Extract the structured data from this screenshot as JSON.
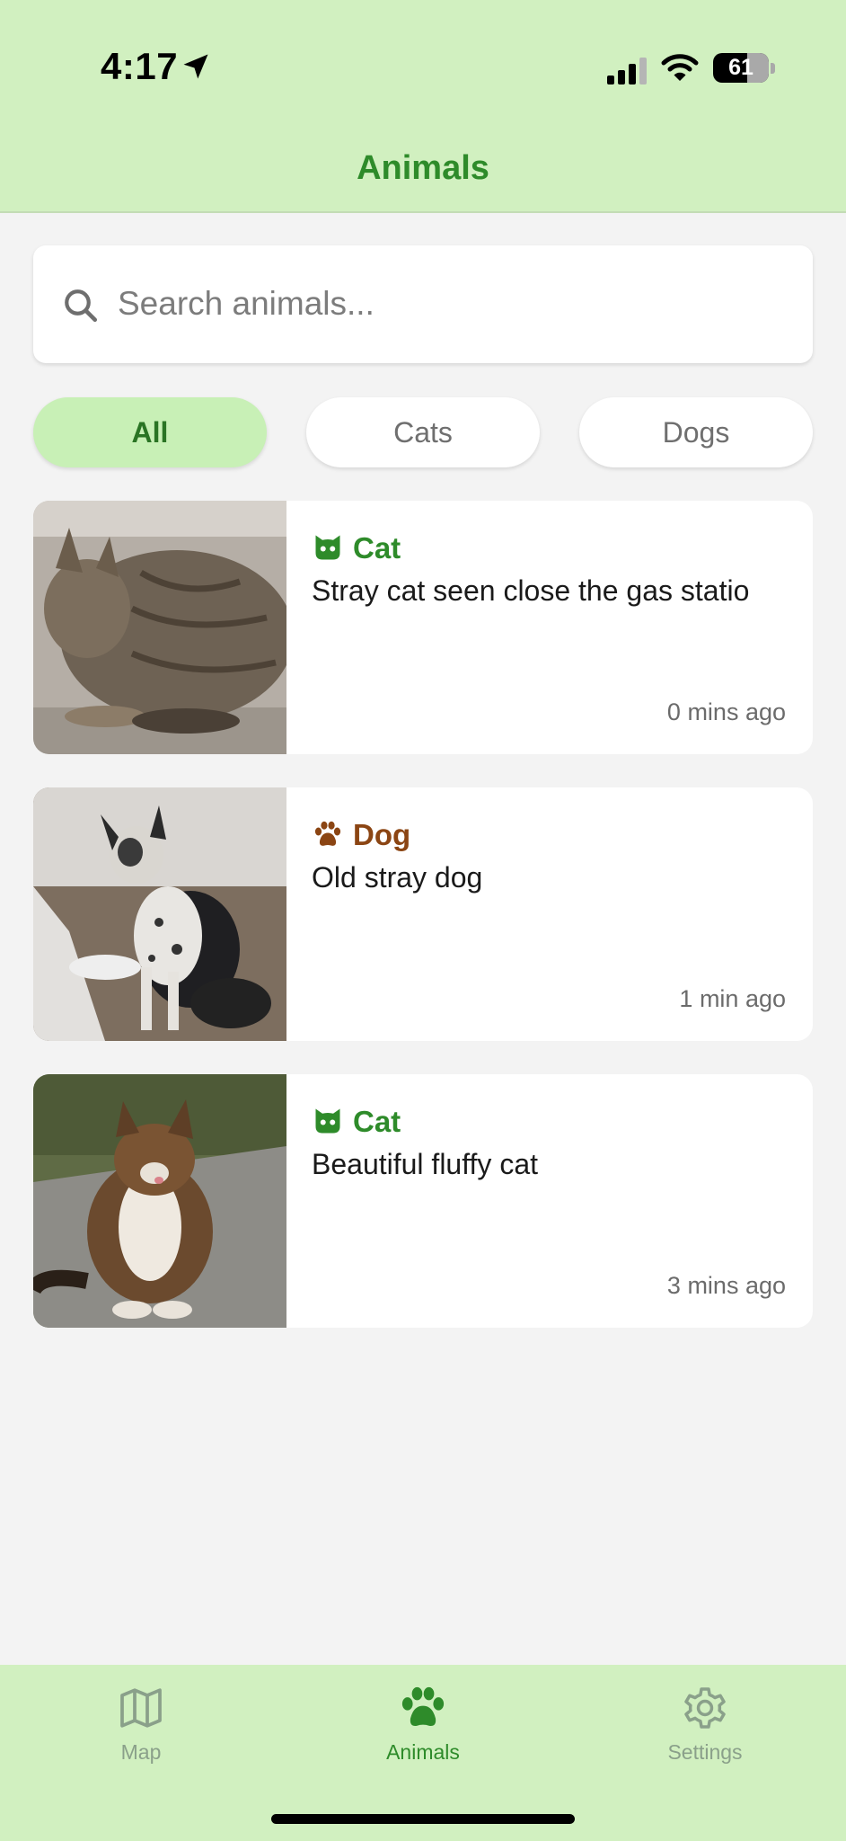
{
  "status_bar": {
    "time": "4:17",
    "battery_percent": "61",
    "icons": [
      "location-arrow-icon",
      "cellular-signal-icon",
      "wifi-icon",
      "battery-icon"
    ]
  },
  "header": {
    "title": "Animals"
  },
  "search": {
    "placeholder": "Search animals...",
    "value": "",
    "icon": "search-icon"
  },
  "filters": {
    "selected": "All",
    "items": [
      {
        "label": "All"
      },
      {
        "label": "Cats"
      },
      {
        "label": "Dogs"
      }
    ]
  },
  "posts": [
    {
      "type": "Cat",
      "icon": "cat-icon",
      "description": "Stray cat seen close the gas statio",
      "time_ago": "0 mins ago",
      "image": "tabby-cat-photo"
    },
    {
      "type": "Dog",
      "icon": "paw-icon",
      "description": "Old stray dog",
      "time_ago": "1 min ago",
      "image": "spotted-dog-photo"
    },
    {
      "type": "Cat",
      "icon": "cat-icon",
      "description": "Beautiful fluffy cat",
      "time_ago": "3 mins ago",
      "image": "fluffy-cat-photo"
    }
  ],
  "tab_bar": {
    "active": "Animals",
    "items": [
      {
        "label": "Map",
        "icon": "map-icon"
      },
      {
        "label": "Animals",
        "icon": "paw-icon"
      },
      {
        "label": "Settings",
        "icon": "gear-icon"
      }
    ]
  },
  "colors": {
    "header_bg": "#d1f0c0",
    "accent_green": "#2e8b2a",
    "dog_brown": "#8b4513",
    "chip_active_bg": "#c8f0b6",
    "page_bg": "#f3f3f3",
    "tab_inactive": "#8aa08a"
  }
}
